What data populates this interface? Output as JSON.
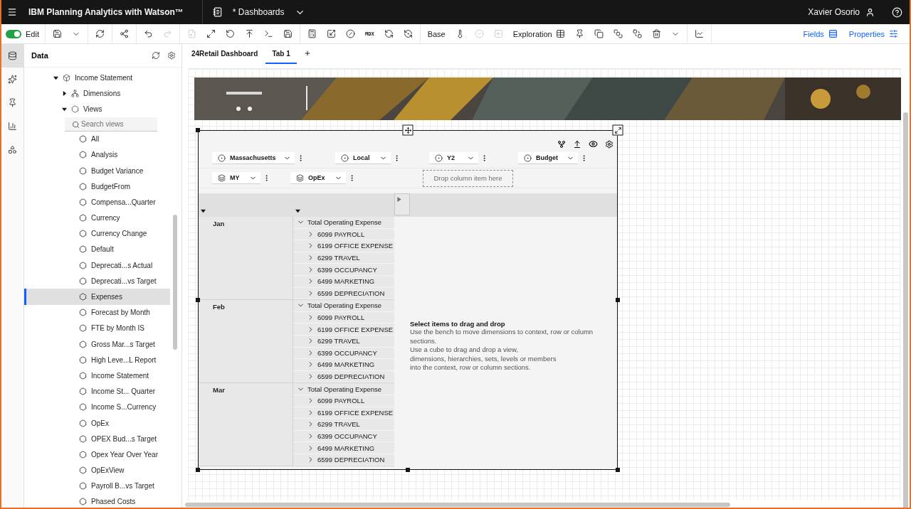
{
  "header": {
    "title": "IBM Planning Analytics with Watson™",
    "document": "* Dashboards",
    "user": "Xavier Osorio"
  },
  "toolbar": {
    "edit": {
      "label": "Edit",
      "on": true
    },
    "groups": [
      [
        {
          "kind": "icon",
          "disabled": false
        },
        {
          "kind": "caret",
          "disabled": false
        }
      ],
      [
        {
          "kind": "icon",
          "disabled": false
        }
      ],
      [
        {
          "kind": "icon",
          "disabled": false
        }
      ],
      [
        {
          "kind": "icon",
          "disabled": false
        },
        {
          "kind": "icon",
          "disabled": true
        }
      ],
      [
        {
          "kind": "icon",
          "disabled": true
        },
        {
          "kind": "icon",
          "disabled": false
        },
        {
          "kind": "icon",
          "disabled": false
        },
        {
          "kind": "icon",
          "disabled": false
        },
        {
          "kind": "icon",
          "disabled": false
        },
        {
          "kind": "icon",
          "disabled": false
        }
      ],
      [
        {
          "kind": "icon",
          "disabled": false
        },
        {
          "kind": "icon",
          "disabled": false
        },
        {
          "kind": "icon",
          "disabled": false
        },
        {
          "kind": "code",
          "label": "MDX",
          "disabled": false
        },
        {
          "kind": "icon",
          "disabled": false
        },
        {
          "kind": "icon",
          "disabled": false
        }
      ],
      [
        {
          "kind": "label",
          "label": "Base",
          "disabled": false
        },
        {
          "kind": "icon",
          "disabled": false
        },
        {
          "kind": "icon",
          "disabled": true
        },
        {
          "kind": "icon",
          "disabled": true
        },
        {
          "kind": "label-icon",
          "label": "Exploration",
          "disabled": false
        },
        {
          "kind": "icon",
          "disabled": false
        },
        {
          "kind": "icon",
          "disabled": false
        },
        {
          "kind": "icon",
          "disabled": false
        },
        {
          "kind": "icon",
          "disabled": false
        },
        {
          "kind": "icon",
          "disabled": false
        },
        {
          "kind": "caret",
          "disabled": false
        }
      ],
      [
        {
          "kind": "icon",
          "disabled": false
        }
      ]
    ],
    "fields": "Fields",
    "properties": "Properties"
  },
  "rail": [
    {
      "selected": true
    },
    {
      "selected": false
    },
    {
      "selected": false
    },
    {
      "selected": false
    },
    {
      "selected": false
    }
  ],
  "data_panel": {
    "title": "Data",
    "tree": [
      {
        "label": "Income Statement",
        "kind": "cube",
        "expanded": true,
        "children": [
          {
            "label": "Dimensions",
            "kind": "dimensions",
            "expanded": false
          },
          {
            "label": "Views",
            "kind": "views",
            "expanded": true,
            "search": {
              "placeholder": "Search views"
            },
            "children": [
              {
                "label": "All",
                "selected": false
              },
              {
                "label": "Analysis",
                "selected": false
              },
              {
                "label": "Budget Variance",
                "selected": false
              },
              {
                "label": "BudgetFrom",
                "selected": false
              },
              {
                "label": "Compensa...Quarter",
                "selected": false
              },
              {
                "label": "Currency",
                "selected": false
              },
              {
                "label": "Currency Change",
                "selected": false
              },
              {
                "label": "Default",
                "selected": false
              },
              {
                "label": "Deprecati...s Actual",
                "selected": false
              },
              {
                "label": "Deprecati...vs Target",
                "selected": false
              },
              {
                "label": "Expenses",
                "selected": true
              },
              {
                "label": "Forecast by Month",
                "selected": false
              },
              {
                "label": "FTE by Month IS",
                "selected": false
              },
              {
                "label": "Gross Mar...s Target",
                "selected": false
              },
              {
                "label": "High Leve...L Report",
                "selected": false
              },
              {
                "label": "Income Statement",
                "selected": false
              },
              {
                "label": "Income St... Quarter",
                "selected": false
              },
              {
                "label": "Income S...Currency",
                "selected": false
              },
              {
                "label": "OpEx",
                "selected": false
              },
              {
                "label": "OPEX Bud...s Target",
                "selected": false
              },
              {
                "label": "Opex Year Over Year",
                "selected": false
              },
              {
                "label": "OpExView",
                "selected": false
              },
              {
                "label": "Payroll B...vs Target",
                "selected": false
              },
              {
                "label": "Phased Costs",
                "selected": false
              }
            ]
          }
        ]
      }
    ]
  },
  "tabs": [
    {
      "label": "24Retail Dashboard",
      "selected": false
    },
    {
      "label": "Tab 1",
      "selected": true
    }
  ],
  "widget": {
    "context": [
      {
        "label": "Massachusetts"
      },
      {
        "label": "Local"
      },
      {
        "label": "Y2"
      },
      {
        "label": "Budget"
      }
    ],
    "row_bench": [
      {
        "label": "MY"
      },
      {
        "label": "OpEx"
      }
    ],
    "drop_placeholder": "Drop column item here",
    "rows": [
      {
        "month": "Jan",
        "members": [
          {
            "label": "Total Operating Expense",
            "expanded": true
          },
          {
            "label": "6099 PAYROLL",
            "expanded": false
          },
          {
            "label": "6199 OFFICE EXPENSE",
            "expanded": false
          },
          {
            "label": "6299 TRAVEL",
            "expanded": false
          },
          {
            "label": "6399 OCCUPANCY",
            "expanded": false
          },
          {
            "label": "6499 MARKETING",
            "expanded": false
          },
          {
            "label": "6599 DEPRECIATION",
            "expanded": false
          }
        ]
      },
      {
        "month": "Feb",
        "members": [
          {
            "label": "Total Operating Expense",
            "expanded": true
          },
          {
            "label": "6099 PAYROLL",
            "expanded": false
          },
          {
            "label": "6199 OFFICE EXPENSE",
            "expanded": false
          },
          {
            "label": "6299 TRAVEL",
            "expanded": false
          },
          {
            "label": "6399 OCCUPANCY",
            "expanded": false
          },
          {
            "label": "6499 MARKETING",
            "expanded": false
          },
          {
            "label": "6599 DEPRECIATION",
            "expanded": false
          }
        ]
      },
      {
        "month": "Mar",
        "members": [
          {
            "label": "Total Operating Expense",
            "expanded": true
          },
          {
            "label": "6099 PAYROLL",
            "expanded": false
          },
          {
            "label": "6199 OFFICE EXPENSE",
            "expanded": false
          },
          {
            "label": "6299 TRAVEL",
            "expanded": false
          },
          {
            "label": "6399 OCCUPANCY",
            "expanded": false
          },
          {
            "label": "6499 MARKETING",
            "expanded": false
          },
          {
            "label": "6599 DEPRECIATION",
            "expanded": false
          }
        ]
      }
    ],
    "message": {
      "title": "Select items to drag and drop",
      "lines": [
        "Use the bench to move dimensions to context, row or column sections.",
        "Use a cube to drag and drop a view,",
        "dimensions, hierarchies, sets, levels or members",
        "into the context, row or column sections."
      ]
    }
  }
}
